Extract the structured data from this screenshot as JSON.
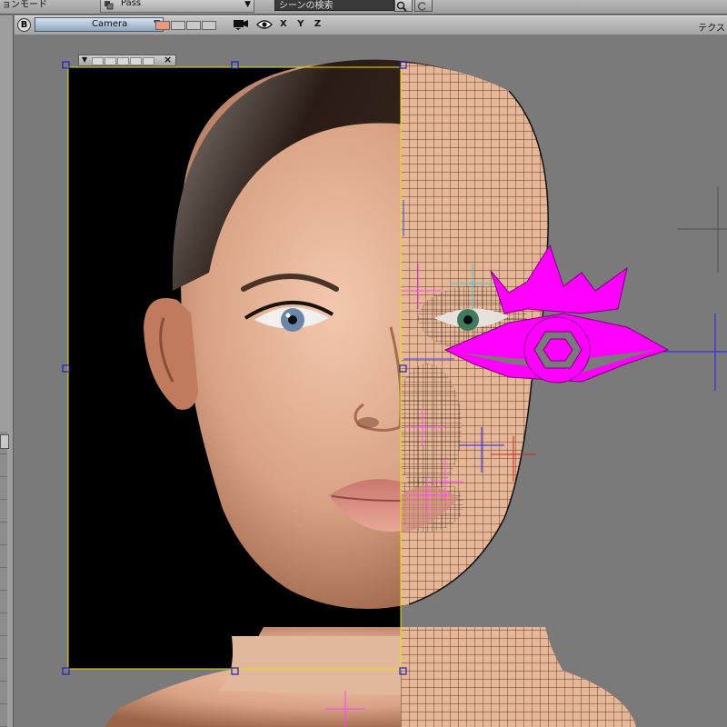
{
  "menubar": {
    "mode_label": "ョンモード",
    "pass_label": "Pass",
    "search_text": "シーンの検索"
  },
  "viewport_toolbar": {
    "b_button": "B",
    "camera_label": "Camera",
    "axes_label": "X Y Z",
    "texture_label": "テクス"
  },
  "icons": [
    "pass-layers-icon",
    "search-icon",
    "refresh-icon",
    "camera-icon",
    "eye-icon",
    "chevron-down-icon",
    "close-icon"
  ],
  "colors": {
    "selection_frame": "#e6e600",
    "handle": "#2020c0",
    "magenta_eye": "#ff00ff",
    "camera_select": "#a9bfd4",
    "wire": "#1b1410",
    "skin": "#e6b79c"
  }
}
